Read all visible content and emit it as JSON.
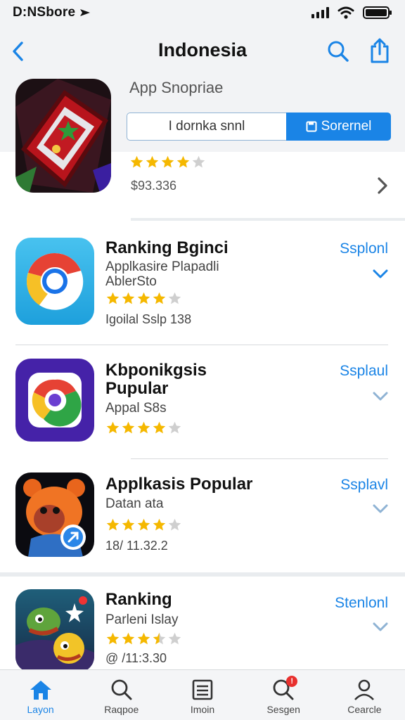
{
  "status_bar": {
    "carrier": "D:NSbore"
  },
  "nav": {
    "title": "Indonesia"
  },
  "featured": {
    "subtitle": "App Snopriae",
    "input_value": "I dornka snnl",
    "button_label": "Sorernel",
    "rating": 4,
    "price": "$93.336"
  },
  "apps": [
    {
      "title_lines": [
        "Ranking Bginci"
      ],
      "subtitle_lines": [
        "Applkasire Plapadli",
        "AblerSto"
      ],
      "rating": 4,
      "meta": "Igoilal  Sslp 138",
      "action": "Ssplonl"
    },
    {
      "title_lines": [
        "Kbponikgsis",
        "Pupular"
      ],
      "subtitle_lines": [
        "Appal S8s"
      ],
      "rating": 4,
      "meta": "",
      "action": "Ssplaul"
    },
    {
      "title_lines": [
        "Applkasis Popular"
      ],
      "subtitle_lines": [
        "Datan ata"
      ],
      "rating": 4,
      "meta": "18/ 11.32.2",
      "action": "Ssplavl"
    },
    {
      "title_lines": [
        "Ranking"
      ],
      "subtitle_lines": [
        "Parleni Islay"
      ],
      "rating": 3.5,
      "meta": "@ /11:3.30",
      "action": "Stenlonl"
    }
  ],
  "tabs": [
    {
      "label": "Layon",
      "icon": "home-icon",
      "active": true
    },
    {
      "label": "Raqpoe",
      "icon": "search-icon",
      "active": false
    },
    {
      "label": "Imoin",
      "icon": "list-icon",
      "active": false
    },
    {
      "label": "Sesgen",
      "icon": "search-badge-icon",
      "badge": "!",
      "active": false
    },
    {
      "label": "Cearcle",
      "icon": "person-icon",
      "active": false
    }
  ],
  "colors": {
    "accent": "#1a84e6",
    "star": "#f5b800",
    "star_empty": "#cfcfcf",
    "header_bg": "#f2f3f5",
    "badge": "#e8302e"
  }
}
